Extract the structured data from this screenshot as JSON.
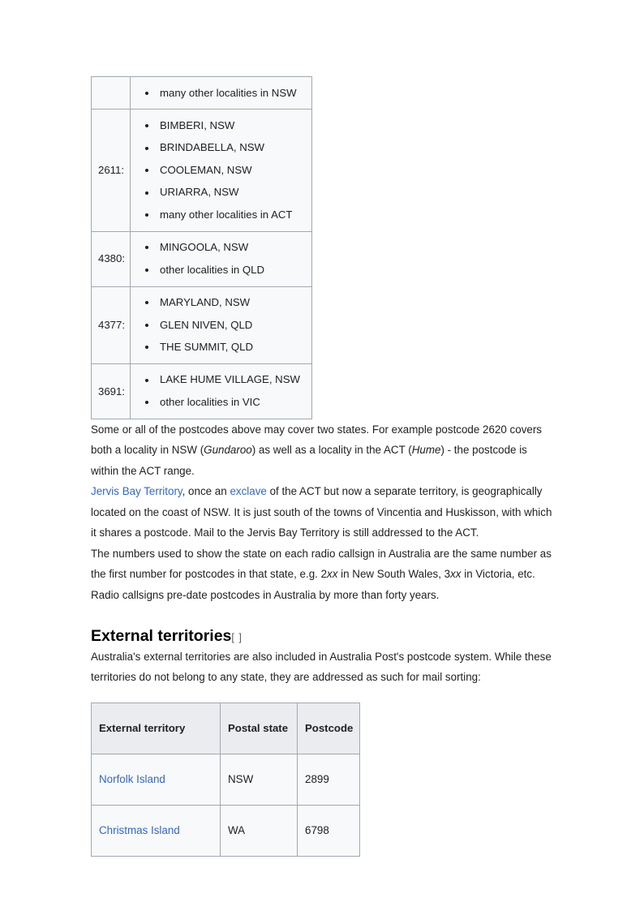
{
  "postcode_table": {
    "rows": [
      {
        "code": "",
        "items": [
          "many other localities in NSW"
        ]
      },
      {
        "code": "2611:",
        "items": [
          "BIMBERI, NSW",
          "BRINDABELLA, NSW",
          "COOLEMAN, NSW",
          "URIARRA, NSW",
          "many other localities in ACT"
        ]
      },
      {
        "code": "4380:",
        "items": [
          "MINGOOLA, NSW",
          "other localities in QLD"
        ]
      },
      {
        "code": "4377:",
        "items": [
          "MARYLAND, NSW",
          "GLEN NIVEN, QLD",
          "THE SUMMIT, QLD"
        ]
      },
      {
        "code": "3691:",
        "items": [
          "LAKE HUME VILLAGE, NSW",
          "other localities in VIC"
        ]
      }
    ]
  },
  "paragraphs": {
    "two_states": {
      "part1": "Some or all of the postcodes above may cover two states. For example postcode 2620 covers both a locality in NSW (",
      "italic1": "Gundaroo",
      "part2": ") as well as a locality in the ACT (",
      "italic2": "Hume",
      "part3": ") - the postcode is within the ACT range."
    },
    "jervis_bay": {
      "link1": "Jervis Bay Territory",
      "part1": ", once an ",
      "link2": "exclave",
      "part2": " of the ACT but now a separate territory, is geographically located on the coast of NSW. It is just south of the towns of Vincentia and Huskisson, with which it shares a postcode. Mail to the Jervis Bay Territory is still addressed to the ACT."
    },
    "callsigns": {
      "part1": "The numbers used to show the state on each radio callsign in Australia are the same number as the first number for postcodes in that state, e.g. 2",
      "italic1": "xx",
      "part2": " in New South Wales, 3",
      "italic2": "xx",
      "part3": " in Victoria, etc. Radio callsigns pre-date postcodes in Australia by more than forty years."
    },
    "external_intro": "Australia's external territories are also included in Australia Post's postcode system. While these territories do not belong to any state, they are addressed as such for mail sorting:"
  },
  "heading": {
    "title": "External territories",
    "edit_bracket": "[ ]"
  },
  "territory_table": {
    "headers": [
      "External territory",
      "Postal state",
      "Postcode"
    ],
    "rows": [
      {
        "territory": "Norfolk Island",
        "state": "NSW",
        "postcode": "2899"
      },
      {
        "territory": "Christmas Island",
        "state": "WA",
        "postcode": "6798"
      }
    ]
  },
  "colors": {
    "link": "#3366cc",
    "text": "#202122",
    "table_border": "#a2a9b1",
    "table_header_bg": "#eaecf0",
    "table_cell_bg": "#f8f9fa"
  }
}
